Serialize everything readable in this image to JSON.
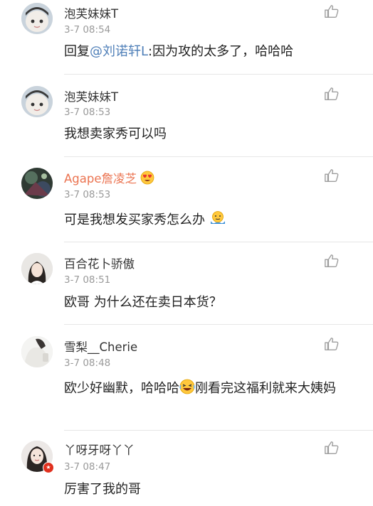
{
  "colors": {
    "username": "#333333",
    "vip_username": "#eb7350",
    "timestamp": "#9a9a9a",
    "mention": "#4f7fb8",
    "divider": "#e6e6e6"
  },
  "comments": [
    {
      "username": "泡芙妹妹T",
      "time": "3-7 08:54",
      "reply_prefix": "回复",
      "mention": "@刘诺轩L",
      "text": ":因为攻的太多了，哈哈哈",
      "like_icon": "thumbs-up-icon"
    },
    {
      "username": "泡芙妹妹T",
      "time": "3-7 08:53",
      "text": "我想卖家秀可以吗",
      "like_icon": "thumbs-up-icon"
    },
    {
      "username": "Agape詹凌芝",
      "username_badge_icon": "heart-eyes-face-icon",
      "time": "3-7 08:53",
      "text": "可是我想发买家秀怎么办",
      "emoji_icon": "shrugging-face-icon",
      "like_icon": "thumbs-up-icon"
    },
    {
      "username": "百合花卜骄傲",
      "time": "3-7 08:51",
      "text": "欧哥  为什么还在卖日本货？",
      "like_icon": "thumbs-up-icon"
    },
    {
      "username": "雪梨__Cherie",
      "time": "3-7 08:48",
      "text_before_emoji": "欧少好幽默，哈哈哈",
      "emoji_icon": "laughing-face-icon",
      "text_after_emoji": "刚看完这福利就来大姨妈",
      "like_icon": "thumbs-up-icon"
    },
    {
      "username": "丫呀牙呀丫丫",
      "avatar_badge_icon": "vip-star-badge-icon",
      "time": "3-7 08:47",
      "text": "厉害了我的哥",
      "like_icon": "thumbs-up-icon"
    }
  ]
}
